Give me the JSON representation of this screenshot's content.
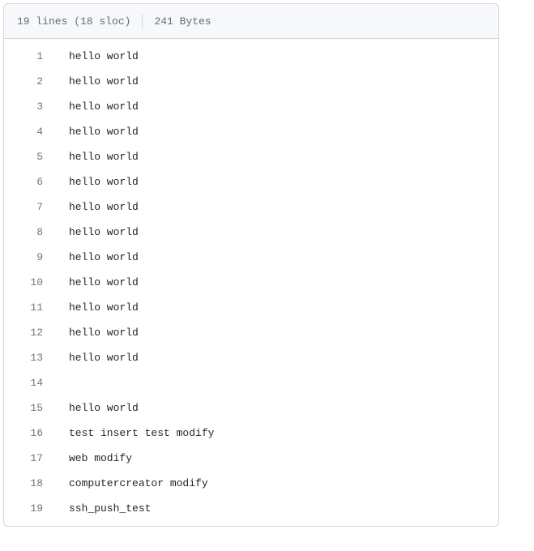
{
  "header": {
    "lines_stat": "19 lines (18 sloc)",
    "bytes_stat": "241 Bytes"
  },
  "lines": [
    {
      "num": "1",
      "text": "hello world"
    },
    {
      "num": "2",
      "text": "hello world"
    },
    {
      "num": "3",
      "text": "hello world"
    },
    {
      "num": "4",
      "text": "hello world"
    },
    {
      "num": "5",
      "text": "hello world"
    },
    {
      "num": "6",
      "text": "hello world"
    },
    {
      "num": "7",
      "text": "hello world"
    },
    {
      "num": "8",
      "text": "hello world"
    },
    {
      "num": "9",
      "text": "hello world"
    },
    {
      "num": "10",
      "text": "hello world"
    },
    {
      "num": "11",
      "text": "hello world"
    },
    {
      "num": "12",
      "text": "hello world"
    },
    {
      "num": "13",
      "text": "hello world"
    },
    {
      "num": "14",
      "text": ""
    },
    {
      "num": "15",
      "text": "hello world"
    },
    {
      "num": "16",
      "text": "test insert test modify"
    },
    {
      "num": "17",
      "text": "web modify"
    },
    {
      "num": "18",
      "text": "computercreator modify"
    },
    {
      "num": "19",
      "text": "ssh_push_test"
    }
  ]
}
